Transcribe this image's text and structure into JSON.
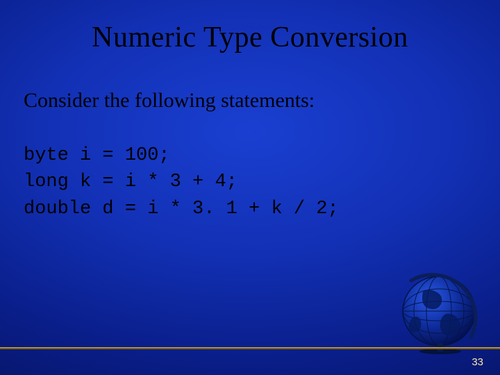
{
  "title": "Numeric Type Conversion",
  "subtitle": "Consider the following statements:",
  "code": {
    "line1": "byte i = 100;",
    "line2": "long k = i * 3 + 4;",
    "line3": "double d = i * 3. 1 + k / 2;"
  },
  "page_number": "33",
  "decor": {
    "globe_icon": "globe-icon"
  }
}
